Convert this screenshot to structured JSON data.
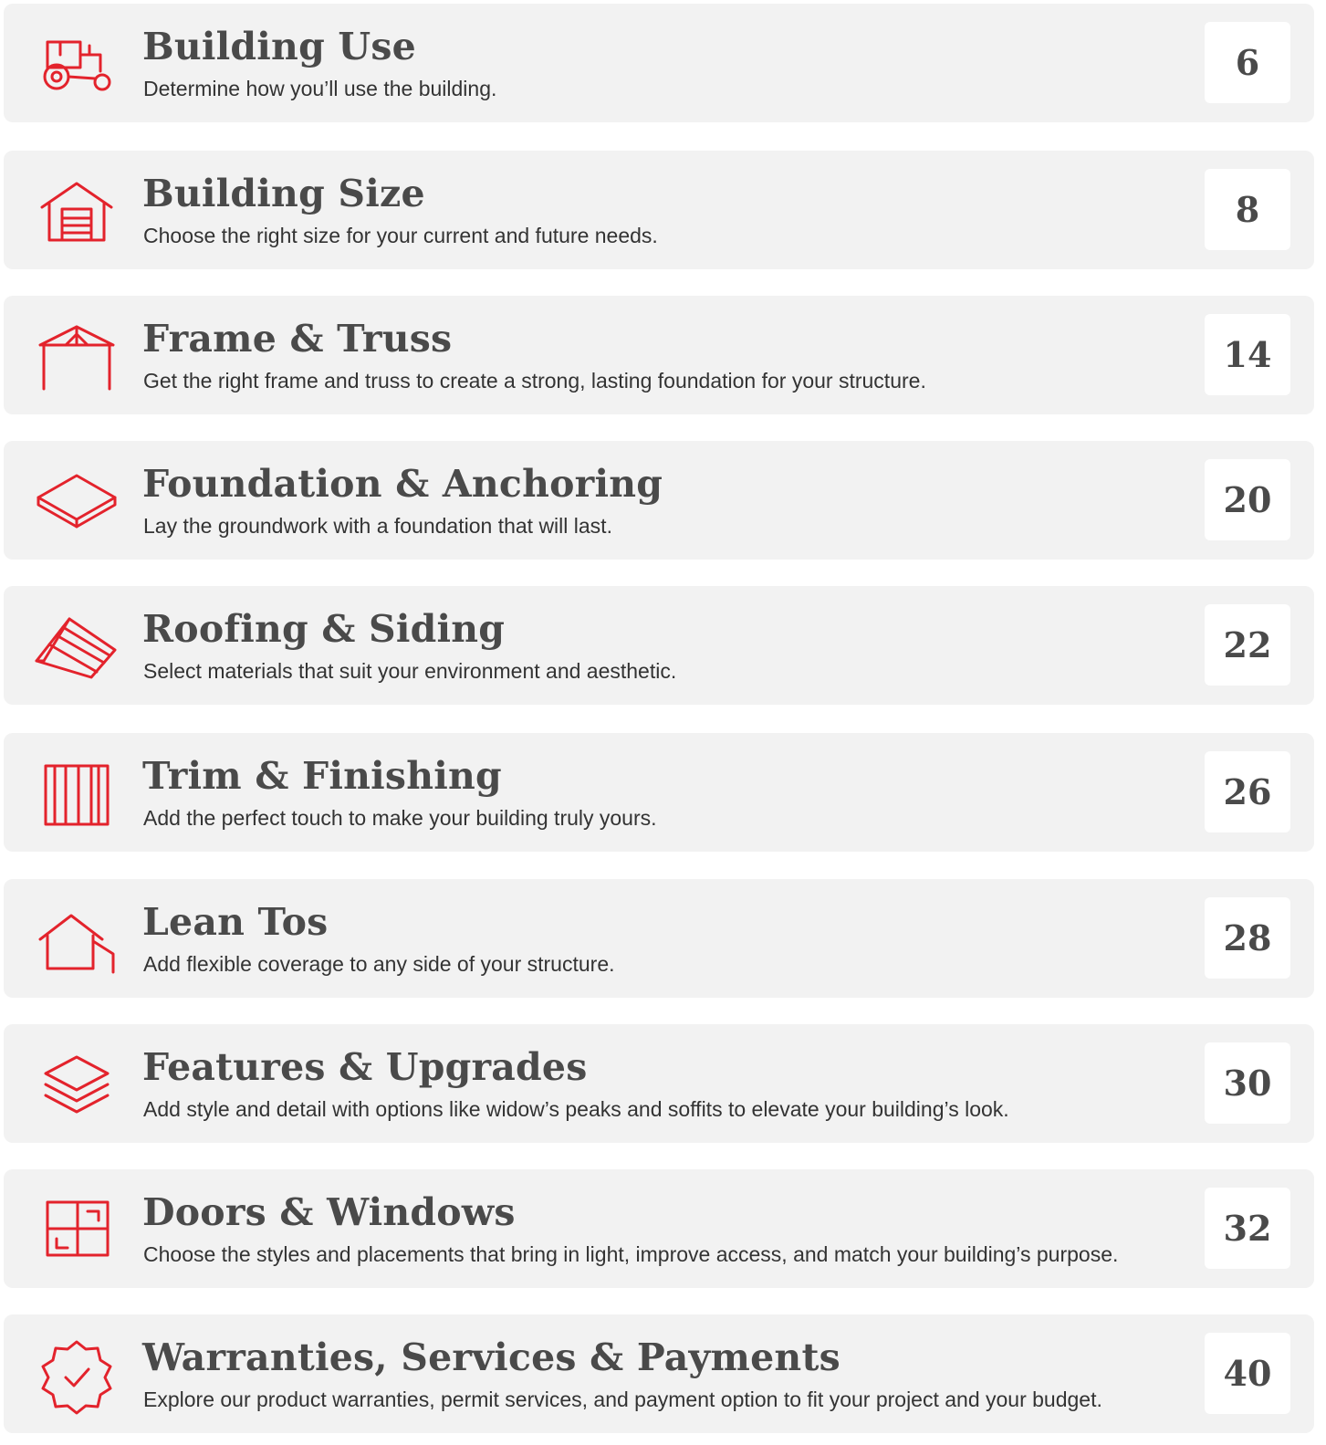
{
  "colors": {
    "accent": "#e3232c",
    "heading": "#4a4a4a",
    "text": "#333333",
    "card_bg": "#f2f2f2"
  },
  "items": [
    {
      "icon": "tractor-icon",
      "title": "Building Use",
      "description": "Determine how you’ll use the building.",
      "page": "6"
    },
    {
      "icon": "garage-icon",
      "title": "Building Size",
      "description": "Choose the right size for your current and future needs.",
      "page": "8"
    },
    {
      "icon": "frame-truss-icon",
      "title": "Frame & Truss",
      "description": "Get the right frame and truss to create a strong, lasting foundation for your structure.",
      "page": "14"
    },
    {
      "icon": "foundation-slab-icon",
      "title": "Foundation & Anchoring",
      "description": "Lay the groundwork with a foundation that will last.",
      "page": "20"
    },
    {
      "icon": "roof-panel-icon",
      "title": "Roofing & Siding",
      "description": "Select materials that suit your environment and aesthetic.",
      "page": "22"
    },
    {
      "icon": "trim-panel-icon",
      "title": "Trim & Finishing",
      "description": "Add the perfect touch to make your building truly yours.",
      "page": "26"
    },
    {
      "icon": "lean-to-icon",
      "title": "Lean Tos",
      "description": "Add flexible coverage to any side of your structure.",
      "page": "28"
    },
    {
      "icon": "layers-icon",
      "title": "Features & Upgrades",
      "description": "Add style and detail with options like widow’s peaks and soffits to elevate your building’s look.",
      "page": "30"
    },
    {
      "icon": "window-icon",
      "title": "Doors & Windows",
      "description": "Choose the styles and placements that bring in light, improve access, and match your building’s purpose.",
      "page": "32"
    },
    {
      "icon": "badge-check-icon",
      "title": "Warranties, Services & Payments",
      "description": "Explore our product warranties, permit services, and payment option to fit your project and your budget.",
      "page": "40"
    }
  ]
}
